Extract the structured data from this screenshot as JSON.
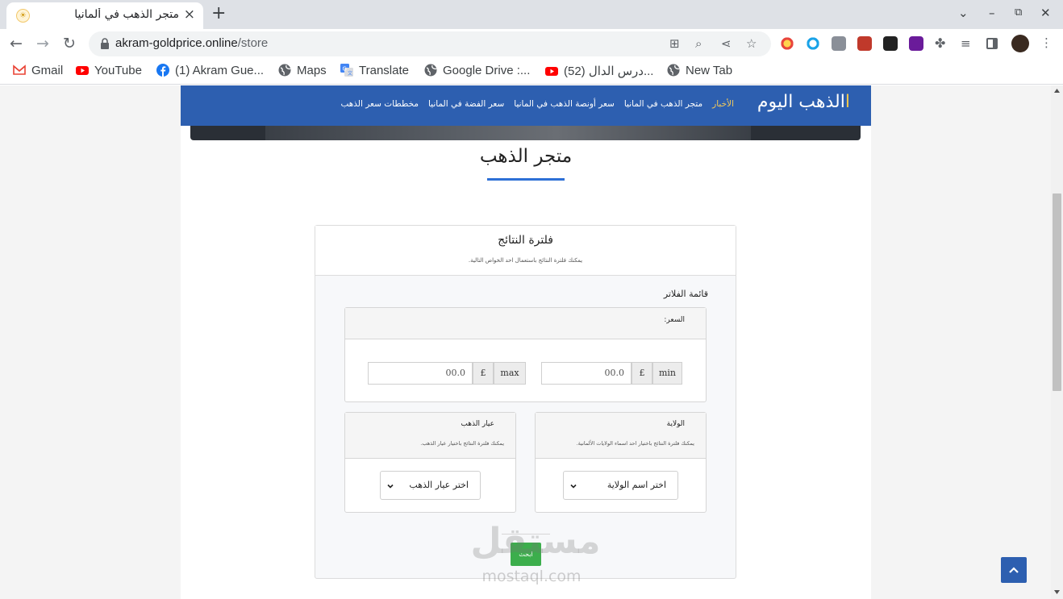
{
  "browser": {
    "tab_title": "متجر الذهب في ألمانيا",
    "tab_close": "×",
    "new_tab": "+",
    "url_domain": "akram-goldprice.online",
    "url_path": "/store",
    "bookmarks": [
      {
        "label": "Gmail",
        "icon": "gmail-icon"
      },
      {
        "label": "YouTube",
        "icon": "youtube-icon"
      },
      {
        "label": "(1) Akram Gue...",
        "icon": "facebook-icon"
      },
      {
        "label": "Maps",
        "icon": "globe-icon"
      },
      {
        "label": "Translate",
        "icon": "translate-icon"
      },
      {
        "label": "Google Drive :...",
        "icon": "globe-icon"
      },
      {
        "label": "(52) درس الدال...",
        "icon": "youtube-icon"
      },
      {
        "label": "New Tab",
        "icon": "globe-icon"
      }
    ]
  },
  "site": {
    "brand": "الذهب اليوم",
    "brand_mark": "ا",
    "nav": [
      {
        "label": "الأخبار",
        "active": true
      },
      {
        "label": "متجر الذهب في المانيا",
        "active": false
      },
      {
        "label": "سعر أونصة الذهب في المانيا",
        "active": false
      },
      {
        "label": "سعر الفضة في المانيا",
        "active": false
      },
      {
        "label": "مخططات سعر الذهب",
        "active": false
      }
    ],
    "page_title": "متجر الذهب"
  },
  "filter": {
    "title": "فلترة النتائج",
    "subtitle": "يمكنك فلترة النتائج باستعمال احد الخواص التالية.",
    "list_label": "قائمة الفلاتر",
    "price": {
      "label": "السعر:",
      "min_label": "min",
      "max_label": "max",
      "currency": "£",
      "min_value": "00.0",
      "max_value": "00.0"
    },
    "state": {
      "title": "الولاية",
      "desc": "يمكنك فلترة النتائج باختيار احد اسماء الولايات الألمانية.",
      "select_value": "اختر اسم الولاية"
    },
    "karat": {
      "title": "عيار الذهب",
      "desc": "يمكنك فلترة النتائج باختيار عيار الذهب.",
      "select_value": "اختر عيار الذهب"
    },
    "search_label": "ابحث"
  },
  "watermark": {
    "arabic": "مستقل",
    "latin": "mostaql.com"
  },
  "colors": {
    "navbar": "#2d5fb0",
    "nav_active": "#f2c95b",
    "underline": "#2d6fd6",
    "search_button": "#3cae4c"
  }
}
